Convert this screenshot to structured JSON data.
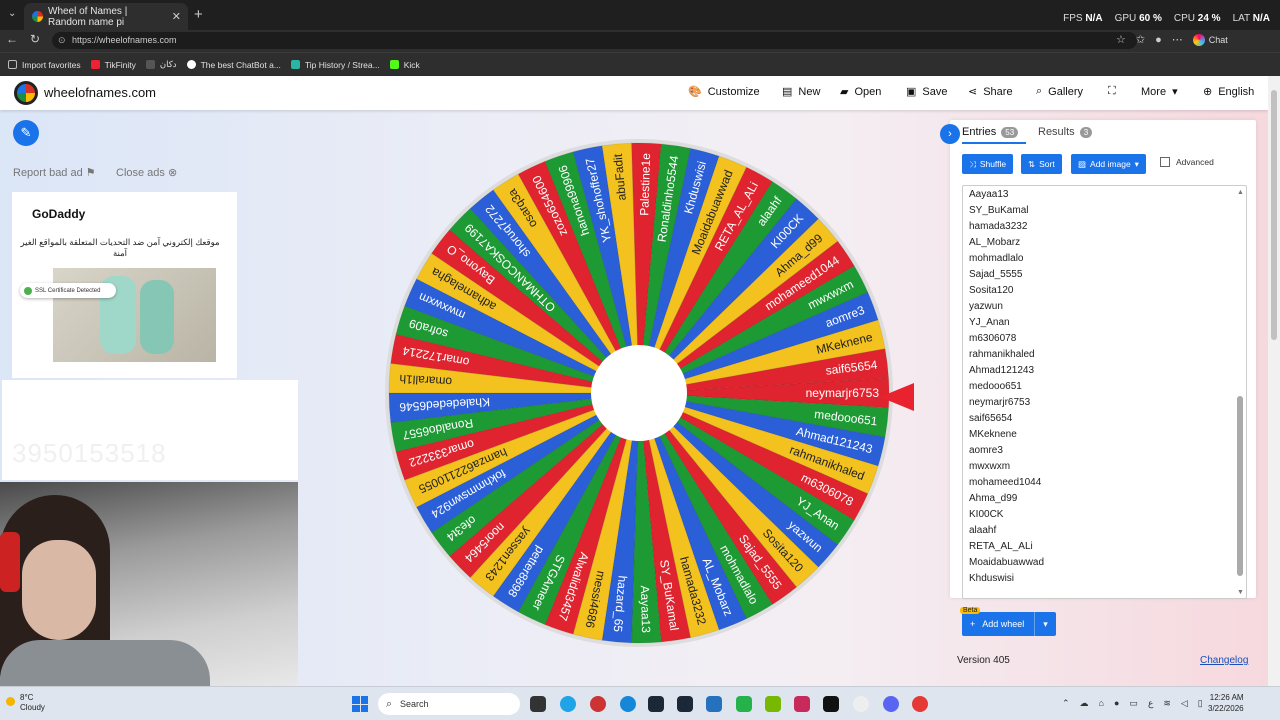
{
  "browser": {
    "tab_title": "Wheel of Names | Random name pi",
    "tab_close": "✕",
    "new_tab": "+",
    "url": "https://wheelofnames.com",
    "stats": {
      "fps_label": "FPS",
      "fps": "N/A",
      "gpu_label": "GPU",
      "gpu": "60 %",
      "cpu_label": "CPU",
      "cpu": "24 %",
      "lat_label": "LAT",
      "lat": "N/A"
    },
    "chat_label": "Chat",
    "bookmarks": [
      "Import favorites",
      "TikFinity",
      "دكان",
      "The best ChatBot a...",
      "Tip History / Strea...",
      "Kick"
    ]
  },
  "site": {
    "brand": "wheelofnames.com",
    "nav": [
      "Customize",
      "New",
      "Open",
      "Save",
      "Share",
      "Gallery",
      "More",
      "English"
    ],
    "report_bad_ad": "Report bad ad",
    "close_ads": "Close ads",
    "ad_brand": "GoDaddy",
    "ad_text": "موقعك إلكتروني آمن ضد التحديات المتعلقة بالمواقع الغير آمنة",
    "ad_badge": "SSL Certificate Detected",
    "faint_text": "3950153518",
    "tabs": {
      "entries": "Entries",
      "entries_count": "53",
      "results": "Results",
      "results_count": "3"
    },
    "buttons": {
      "shuffle": "Shuffle",
      "sort": "Sort",
      "add_image": "Add image",
      "advanced": "Advanced"
    },
    "entries": [
      "Aayaa13",
      "SY_BuKamal",
      "hamada3232",
      "AL_Mobarz",
      "mohmadlalo",
      "Sajad_5555",
      "Sosita120",
      "yazwun",
      "YJ_Anan",
      "m6306078",
      "rahmanikhaled",
      "Ahmad121243",
      "medooo651",
      "neymarjr6753",
      "saif65654",
      "MKeknene",
      "aomre3",
      "mwxwxm",
      "mohameed1044",
      "Ahma_d99",
      "KI00CK",
      "alaahf",
      "RETA_AL_ALi",
      "Moaidabuawwad",
      "Khduswisi"
    ],
    "beta": "Beta",
    "add_wheel": "Add wheel",
    "version": "Version 405",
    "changelog": "Changelog"
  },
  "wheel": {
    "colors": [
      "#e0242f",
      "#1e9a35",
      "#2a5fd8",
      "#f4c21e"
    ],
    "names": [
      "neymarjr6753",
      "medooo651",
      "Ahmad121243",
      "rahmanikhaled",
      "m6306078",
      "YJ_Anan",
      "yazwun",
      "Sosita120",
      "Sajad_5555",
      "mohmadlalo",
      "AL_Mobarz",
      "hamada3232",
      "SY_BuKamal",
      "Aayaa13",
      "hazard_65",
      "messi4686",
      "Alwalidd3457",
      "STGAmeer",
      "petter8898",
      "yassen1243",
      "noor5464",
      "ofe3t4",
      "fokhmmswn924",
      "hamza622110055",
      "omar333222",
      "Ronaldo6557",
      "Khalededed6546",
      "omarall1h",
      "omar172214",
      "sofra09",
      "mwxwxm",
      "adhamelagha",
      "Bayono_O",
      "OTHMANCOSKA7199",
      "shoruq7272",
      "osarq3a",
      "zozo654600",
      "hanona99906",
      "YK_shohoffer27",
      "abuFadit",
      "Palestine1e",
      "Ronaldinho5544",
      "Khduswisi",
      "Moaidabuawwad",
      "RETA_AL_ALi",
      "alaahf",
      "KI00CK",
      "Ahma_d99",
      "mohameed1044",
      "mwxwxm",
      "aomre3",
      "MKeknene",
      "saif65654"
    ]
  },
  "taskbar": {
    "temp": "8°C",
    "weather": "Cloudy",
    "search": "Search",
    "time": "12:26 AM",
    "date": "3/22/2026"
  }
}
